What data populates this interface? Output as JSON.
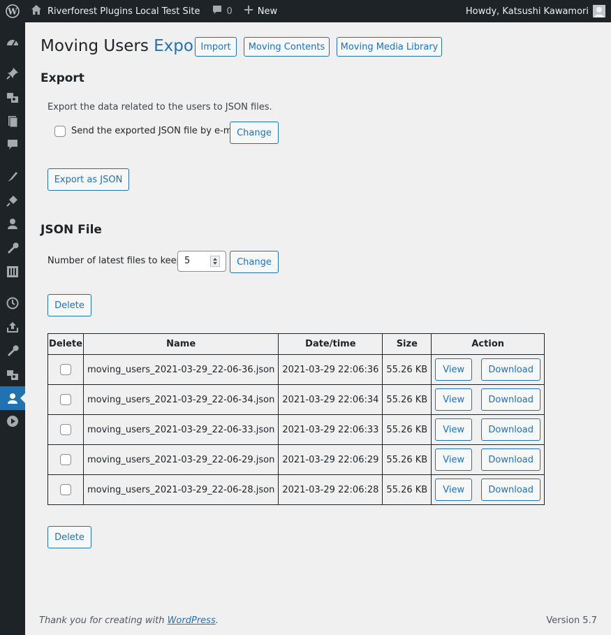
{
  "admin_bar": {
    "site_name": "Riverforest Plugins Local Test Site",
    "comments_count": "0",
    "new_label": "New",
    "user_greeting": "Howdy, Katsushi Kawamori"
  },
  "sidebar": {
    "icons": [
      "dashboard-icon",
      "pin-icon",
      "media-icon",
      "pages-icon",
      "comments-icon",
      "appearance-icon",
      "plugins-icon",
      "users-icon",
      "tools-icon",
      "settings-icon",
      "clock-icon",
      "upload-icon",
      "wrench-icon",
      "media-library-icon",
      "users-export-icon",
      "play-icon"
    ],
    "current": "users-export-icon"
  },
  "header": {
    "title": "Moving Users",
    "title_highlight": "Export",
    "tabs": [
      "Import",
      "Moving Contents",
      "Moving Media Library"
    ]
  },
  "export_section": {
    "heading": "Export",
    "description": "Export the data related to the users to JSON files.",
    "email_checkbox_label": "Send the exported JSON file by e-mail",
    "change_label": "Change",
    "export_button": "Export as JSON"
  },
  "json_section": {
    "heading": "JSON File",
    "keep_label": "Number of latest files to keep :",
    "keep_value": "5",
    "change_label": "Change",
    "delete_label": "Delete"
  },
  "table": {
    "headers": [
      "Delete",
      "Name",
      "Date/time",
      "Size",
      "Action"
    ],
    "view_label": "View",
    "download_label": "Download",
    "rows": [
      {
        "name": "moving_users_2021-03-29_22-06-36.json",
        "datetime": "2021-03-29 22:06:36",
        "size": "55.26 KB"
      },
      {
        "name": "moving_users_2021-03-29_22-06-34.json",
        "datetime": "2021-03-29 22:06:34",
        "size": "55.26 KB"
      },
      {
        "name": "moving_users_2021-03-29_22-06-33.json",
        "datetime": "2021-03-29 22:06:33",
        "size": "55.26 KB"
      },
      {
        "name": "moving_users_2021-03-29_22-06-29.json",
        "datetime": "2021-03-29 22:06:29",
        "size": "55.26 KB"
      },
      {
        "name": "moving_users_2021-03-29_22-06-28.json",
        "datetime": "2021-03-29 22:06:28",
        "size": "55.26 KB"
      }
    ]
  },
  "footer": {
    "thanks_prefix": "Thank you for creating with ",
    "thanks_link": "WordPress",
    "thanks_suffix": ".",
    "version": "Version 5.7"
  },
  "colors": {
    "accent": "#2271b1",
    "adminbar": "#1d2327",
    "background": "#f0f0f1"
  }
}
